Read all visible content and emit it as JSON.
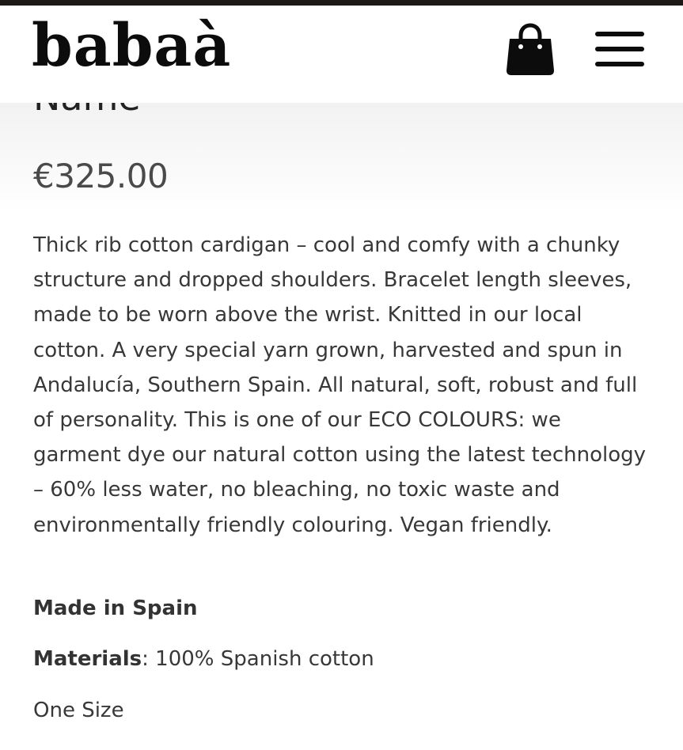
{
  "header": {
    "logo_text": "babaà",
    "bag_icon": "shopping-bag-icon",
    "menu_icon": "hamburger-menu-icon"
  },
  "product": {
    "title": "Name",
    "price": "€325.00",
    "description": "Thick rib cotton cardigan – cool and comfy with a chunky structure and dropped shoulders. Bracelet length sleeves, made to be worn above the wrist. Knitted in our local cotton. A very special yarn grown, harvested and spun in Andalucía, Southern Spain. All natural, soft, robust and full of personality. This is one of our ECO COLOURS: we garment dye our natural cotton using the latest technology – 60% less water, no bleaching, no toxic waste and environmentally friendly colouring. Vegan friendly.",
    "made_in": "Made in Spain",
    "materials_label": "Materials",
    "materials_value": ": 100% Spanish cotton",
    "size": "One Size"
  },
  "colors": {
    "top_strip": "#1c1a17",
    "text": "#383838",
    "logo": "#0c0c0c"
  }
}
